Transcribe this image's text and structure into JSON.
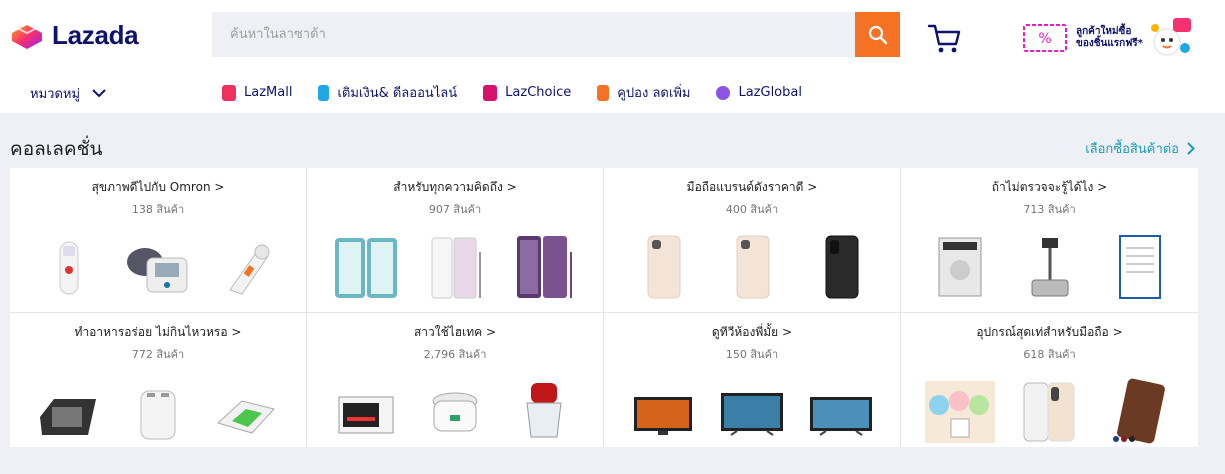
{
  "logo": {
    "text": "Lazada"
  },
  "search": {
    "placeholder": "ค้นหาในลาซาด้า"
  },
  "promo": {
    "line1": "ลูกค้าใหม่ซื้อ",
    "line2": "ของชิ้นแรกฟรี*",
    "ticket_symbol": "%"
  },
  "category_menu": {
    "label": "หมวดหมู่"
  },
  "nav": [
    {
      "label": "LazMall",
      "icon": "lazmall-icon",
      "color": "#f0305f"
    },
    {
      "label": "เติมเงิน& ดีลออนไลน์",
      "icon": "topup-icon",
      "color": "#21a7e6"
    },
    {
      "label": "LazChoice",
      "icon": "lazchoice-icon",
      "color": "#d6126a"
    },
    {
      "label": "คูปอง ลดเพิ่ม",
      "icon": "voucher-icon",
      "color": "#f57224"
    },
    {
      "label": "LazGlobal",
      "icon": "lazglobal-icon",
      "color": "#8c53e5"
    }
  ],
  "section": {
    "title": "คอลเลคชั่น",
    "shop_more": "เลือกซื้อสินค้าต่อ"
  },
  "collections": [
    {
      "title": "สุขภาพดีไปกับ Omron >",
      "count": "138 สินค้า",
      "images": [
        "forehead-thermometer",
        "blood-pressure-monitor",
        "ear-thermometer"
      ]
    },
    {
      "title": "สำหรับทุกความคิดถึง >",
      "count": "907 สินค้า",
      "images": [
        "oppo-phones",
        "galaxy-note-white",
        "galaxy-note-purple"
      ]
    },
    {
      "title": "มือถือแบรนด์ดังราคาดี >",
      "count": "400 สินค้า",
      "images": [
        "iphone-gold",
        "iphone-gold",
        "iphone-black"
      ]
    },
    {
      "title": "ถ้าไม่ตรวจจะรู้ได้ไง >",
      "count": "713 สินค้า",
      "images": [
        "product-box",
        "body-scale",
        "certificate"
      ]
    },
    {
      "title": "ทำอาหารอร่อย ไม่กินไหวหรอ >",
      "count": "772 สินค้า",
      "images": [
        "waffle-maker",
        "toaster",
        "sandwich-maker"
      ]
    },
    {
      "title": "สาวใช้ไฮเทค >",
      "count": "2,796 สินค้า",
      "images": [
        "toaster-oven",
        "rice-cooker",
        "food-chopper"
      ]
    },
    {
      "title": "ดูทีวีห้องพี่มั้ย >",
      "count": "150 สินค้า",
      "images": [
        "tv-lg",
        "tv-samsung",
        "tv-samsung"
      ]
    },
    {
      "title": "อุปกรณ์สุดเท่สำหรับมือถือ >",
      "count": "618 สินค้า",
      "images": [
        "cute-phone-stands",
        "iphone-xs",
        "leather-phone-case"
      ]
    }
  ],
  "colors": {
    "brand_orange": "#f57224",
    "brand_navy": "#0f136d",
    "link_teal": "#1a9cb7"
  }
}
